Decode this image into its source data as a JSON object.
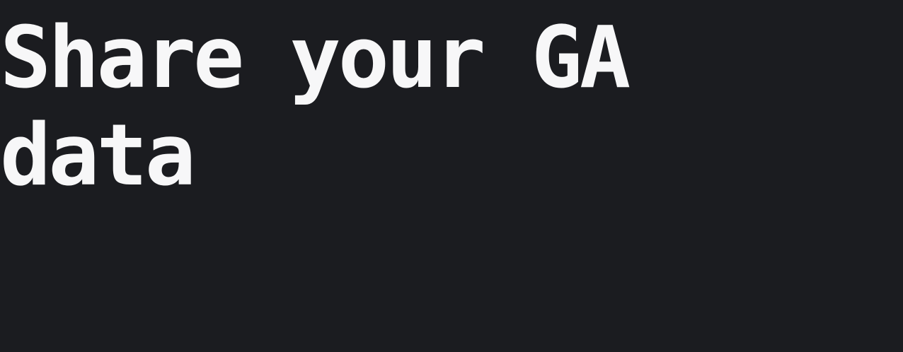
{
  "hero": {
    "title": "Share your GA\ndata"
  },
  "theme": {
    "background": "#1b1c20",
    "text": "#f7f7f8"
  }
}
